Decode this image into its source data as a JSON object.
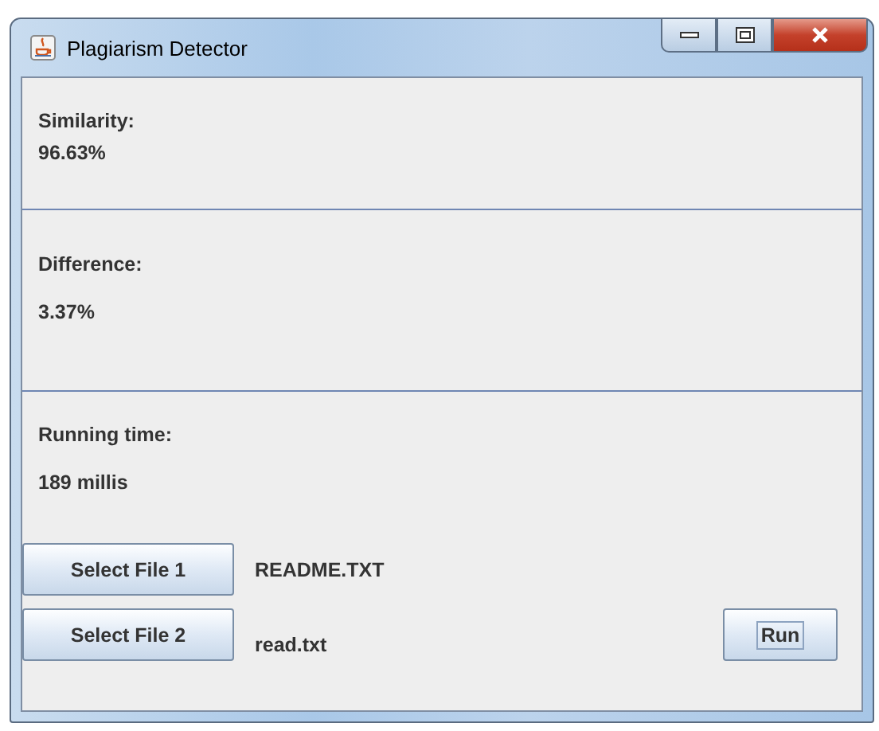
{
  "window": {
    "title": "Plagiarism Detector"
  },
  "results": [
    {
      "label": "Similarity:",
      "value": "96.63%"
    },
    {
      "label": "Difference:",
      "value": "3.37%"
    },
    {
      "label": "Running time:",
      "value": "189 millis"
    }
  ],
  "files": [
    {
      "button": "Select File 1",
      "file": "README.TXT"
    },
    {
      "button": "Select File 2",
      "file": "read.txt"
    }
  ],
  "run_button": {
    "label": "Run",
    "focused": true
  }
}
